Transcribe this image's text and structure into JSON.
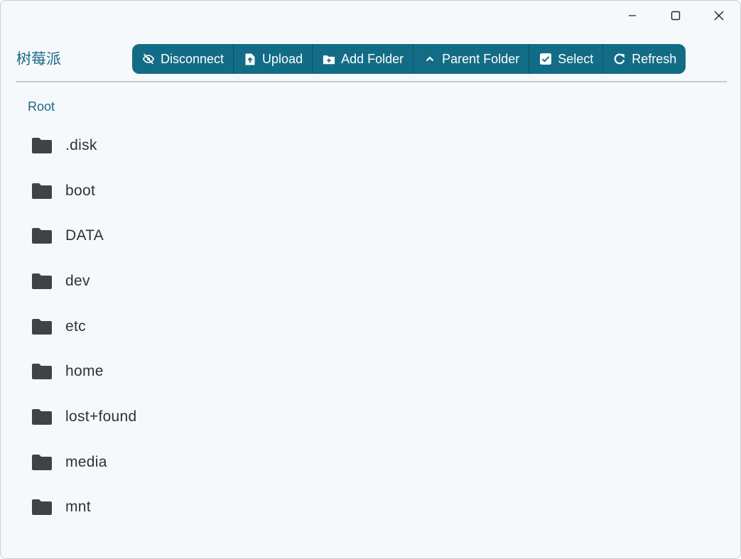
{
  "app": {
    "title": "树莓派"
  },
  "window_controls": [
    "minimize-icon",
    "maximize-icon",
    "close-icon"
  ],
  "toolbar": {
    "buttons": [
      {
        "label": "Disconnect",
        "icon": "disconnect-icon"
      },
      {
        "label": "Upload",
        "icon": "upload-file-icon"
      },
      {
        "label": "Add Folder",
        "icon": "add-folder-icon"
      },
      {
        "label": "Parent Folder",
        "icon": "chevron-up-icon"
      },
      {
        "label": "Select",
        "icon": "checkbox-icon"
      },
      {
        "label": "Refresh",
        "icon": "refresh-icon"
      }
    ]
  },
  "breadcrumb": {
    "label": "Root"
  },
  "files": [
    {
      "name": ".disk",
      "icon": "folder-icon"
    },
    {
      "name": "boot",
      "icon": "folder-icon"
    },
    {
      "name": "DATA",
      "icon": "folder-icon"
    },
    {
      "name": "dev",
      "icon": "folder-icon"
    },
    {
      "name": "etc",
      "icon": "folder-icon"
    },
    {
      "name": "home",
      "icon": "folder-icon"
    },
    {
      "name": "lost+found",
      "icon": "folder-icon"
    },
    {
      "name": "media",
      "icon": "folder-icon"
    },
    {
      "name": "mnt",
      "icon": "folder-icon"
    }
  ],
  "colors": {
    "accent": "#136c85",
    "background": "#f5f9fc",
    "text": "#2d3236",
    "folder": "#3d4347"
  }
}
